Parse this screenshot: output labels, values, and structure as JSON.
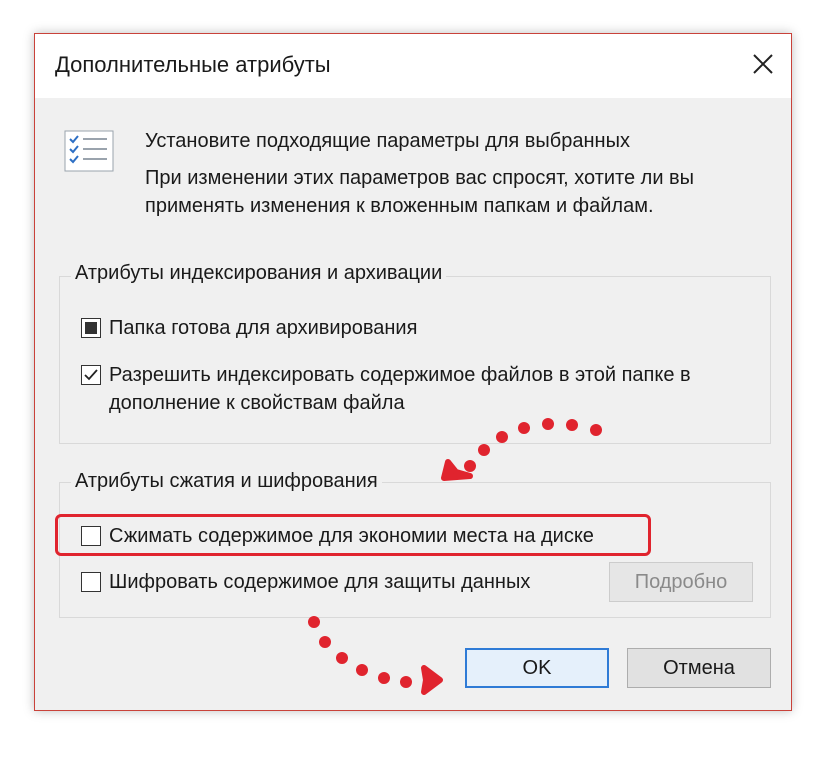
{
  "dialog": {
    "title": "Дополнительные атрибуты",
    "close_icon": "close-icon",
    "header_icon": "checklist-icon",
    "intro_line1": "Установите подходящие параметры для выбранных",
    "intro_line2": "При изменении этих параметров вас спросят, хотите ли вы применять изменения к вложенным папкам и файлам."
  },
  "index_group": {
    "title": "Атрибуты индексирования и архивации",
    "archive": {
      "label": "Папка готова для архивирования",
      "state": "indeterminate"
    },
    "index": {
      "label": "Разрешить индексировать содержимое файлов в этой папке в дополнение к свойствам файла",
      "state": "checked"
    }
  },
  "compress_group": {
    "title": "Атрибуты сжатия и шифрования",
    "compress": {
      "label": "Сжимать содержимое для экономии места на диске",
      "state": "unchecked"
    },
    "encrypt": {
      "label": "Шифровать содержимое для защиты данных",
      "state": "unchecked"
    },
    "details_button": "Подробно"
  },
  "buttons": {
    "ok": "OK",
    "cancel": "Отмена"
  },
  "colors": {
    "annotation": "#e0242e",
    "focus": "#2f7bd6",
    "dialog_bg": "#f0f0f0"
  }
}
